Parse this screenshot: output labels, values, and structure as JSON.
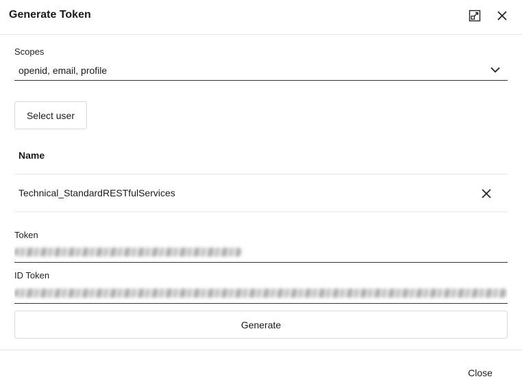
{
  "dialog": {
    "title": "Generate Token",
    "header_icons": [
      "expand-icon",
      "close-icon"
    ]
  },
  "scopes": {
    "label": "Scopes",
    "value": "openid, email, profile",
    "icon": "chevron-down-icon"
  },
  "select_user_button": "Select user",
  "users_table": {
    "columns": [
      "Name"
    ],
    "rows": [
      {
        "name": "Technical_StandardRESTfulServices",
        "action_icon": "close-icon"
      }
    ]
  },
  "token": {
    "label": "Token"
  },
  "id_token": {
    "label": "ID Token"
  },
  "generate_button": "Generate",
  "footer": {
    "close_label": "Close"
  }
}
